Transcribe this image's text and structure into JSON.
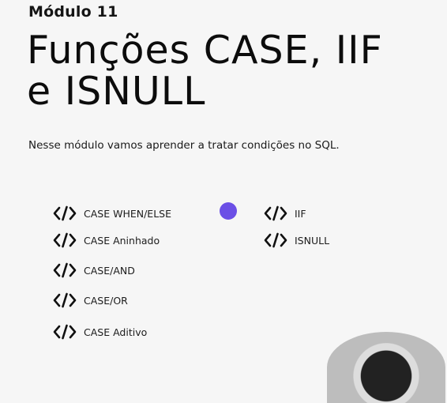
{
  "module_label": "Módulo 11",
  "title_line1": "Funções CASE, IIF",
  "title_line2": "e ISNULL",
  "subtitle": "Nesse módulo vamos aprender a tratar condições no SQL.",
  "topics_left": [
    {
      "label": "CASE WHEN/ELSE",
      "icon": "code-icon"
    },
    {
      "label": "CASE Aninhado",
      "icon": "code-icon"
    },
    {
      "label": "CASE/AND",
      "icon": "code-icon"
    },
    {
      "label": "CASE/OR",
      "icon": "code-icon"
    },
    {
      "label": "CASE Aditivo",
      "icon": "code-icon"
    }
  ],
  "topics_right": [
    {
      "label": "IIF",
      "icon": "code-icon"
    },
    {
      "label": "ISNULL",
      "icon": "code-icon"
    }
  ],
  "colors": {
    "accent_dot": "#6b4fe6",
    "background": "#f6f6f6",
    "text": "#111111"
  }
}
